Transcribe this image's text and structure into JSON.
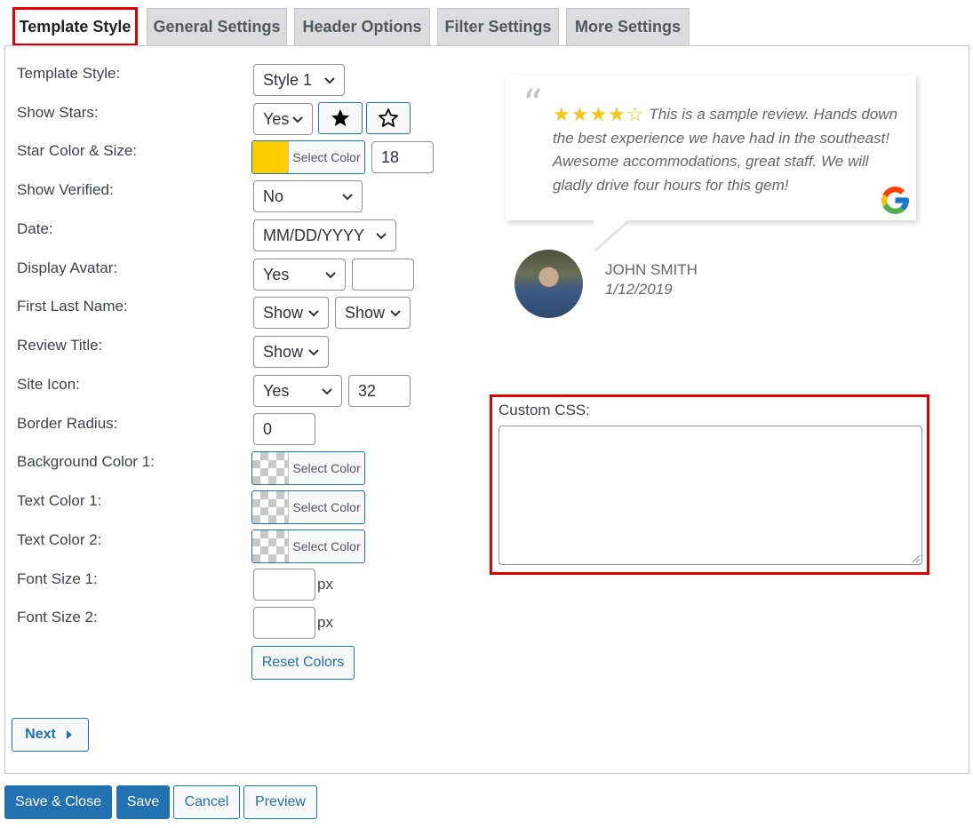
{
  "tabs": [
    {
      "label": "Template Style",
      "active": true
    },
    {
      "label": "General Settings"
    },
    {
      "label": "Header Options"
    },
    {
      "label": "Filter Settings"
    },
    {
      "label": "More Settings"
    }
  ],
  "settings": {
    "template_style": {
      "label": "Template Style:",
      "value": "Style 1"
    },
    "show_stars": {
      "label": "Show Stars:",
      "value": "Yes"
    },
    "star_color_size": {
      "label": "Star Color & Size:",
      "color": "#ffcc00",
      "button": "Select Color",
      "size": "18"
    },
    "show_verified": {
      "label": "Show Verified:",
      "value": "No"
    },
    "date": {
      "label": "Date:",
      "value": "MM/DD/YYYY"
    },
    "display_avatar": {
      "label": "Display Avatar:",
      "value": "Yes",
      "extra": ""
    },
    "first_last_name": {
      "label": "First Last Name:",
      "first": "Show",
      "last": "Show"
    },
    "review_title": {
      "label": "Review Title:",
      "value": "Show"
    },
    "site_icon": {
      "label": "Site Icon:",
      "value": "Yes",
      "size": "32"
    },
    "border_radius": {
      "label": "Border Radius:",
      "value": "0"
    },
    "background_color_1": {
      "label": "Background Color 1:",
      "button": "Select Color"
    },
    "text_color_1": {
      "label": "Text Color 1:",
      "button": "Select Color"
    },
    "text_color_2": {
      "label": "Text Color 2:",
      "button": "Select Color"
    },
    "font_size_1": {
      "label": "Font Size 1:",
      "value": "",
      "unit": "px"
    },
    "font_size_2": {
      "label": "Font Size 2:",
      "value": "",
      "unit": "px"
    },
    "reset_colors": "Reset Colors"
  },
  "preview": {
    "stars": "★★★★☆",
    "review_text": "This is a sample review. Hands down the best experience we have had in the southeast! Awesome accommodations, great staff. We will gladly drive four hours for this gem!",
    "reviewer_name": "JOHN SMITH",
    "review_date": "1/12/2019"
  },
  "custom_css": {
    "label": "Custom CSS:",
    "value": ""
  },
  "next_label": "Next",
  "footer": {
    "save_close": "Save & Close",
    "save": "Save",
    "cancel": "Cancel",
    "preview": "Preview"
  },
  "colors": {
    "accent": "#2271b1",
    "highlight": "#e00000",
    "star": "#f5c518"
  }
}
